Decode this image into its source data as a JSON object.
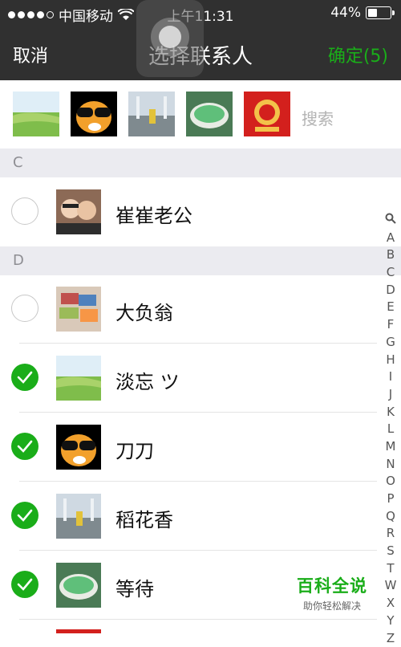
{
  "status_bar": {
    "carrier": "中国移动",
    "time": "上午11:31",
    "battery_pct": "44%",
    "battery_level": 0.44
  },
  "nav": {
    "cancel": "取消",
    "title": "选择联系人",
    "confirm": "确定(5)"
  },
  "selected_strip": {
    "thumbs": [
      "green-field",
      "cartoon-face",
      "fountain-photo",
      "green-soup",
      "red-poster"
    ],
    "search_placeholder": "搜索"
  },
  "sections": [
    {
      "letter": "C",
      "contacts": [
        {
          "name": "崔崔老公",
          "checked": false
        }
      ]
    },
    {
      "letter": "D",
      "contacts": [
        {
          "name": "大负翁",
          "checked": false
        },
        {
          "name": "淡忘 ツ",
          "checked": true
        },
        {
          "name": "刀刀",
          "checked": true
        },
        {
          "name": "稻花香",
          "checked": true
        },
        {
          "name": "等待",
          "checked": true
        }
      ]
    }
  ],
  "index": [
    "A",
    "B",
    "C",
    "D",
    "E",
    "F",
    "G",
    "H",
    "I",
    "J",
    "K",
    "L",
    "M",
    "N",
    "O",
    "P",
    "Q",
    "R",
    "S",
    "T",
    "W",
    "X",
    "Y",
    "Z"
  ],
  "watermark": {
    "main": "百科全说",
    "sub": "助你轻松解决"
  },
  "colors": {
    "accent": "#1aad19",
    "bar": "#303030",
    "section_bg": "#ebebf0"
  }
}
